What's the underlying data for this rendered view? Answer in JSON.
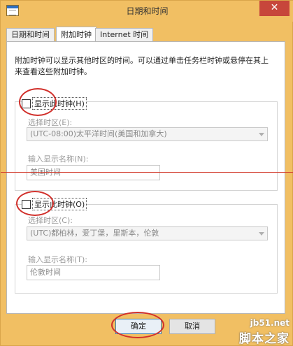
{
  "window": {
    "title": "日期和时间",
    "close_glyph": "✕"
  },
  "tabs": [
    {
      "label": "日期和时间"
    },
    {
      "label": "附加时钟"
    },
    {
      "label": "Internet 时间"
    }
  ],
  "description": "附加时钟可以显示其他时区的时间。可以通过单击任务栏时钟或悬停在其上来查看这些附加时钟。",
  "clock1": {
    "checkbox_label": "显示此时钟(H)",
    "checked": false,
    "timezone_label": "选择时区(E):",
    "timezone_value": "(UTC-08:00)太平洋时间(美国和加拿大)",
    "name_label": "输入显示名称(N):",
    "name_value": "美国时间"
  },
  "clock2": {
    "checkbox_label": "显示此时钟(O)",
    "checked": false,
    "timezone_label": "选择时区(C):",
    "timezone_value": "(UTC)都柏林，爱丁堡，里斯本，伦敦",
    "name_label": "输入显示名称(T):",
    "name_value": "伦敦时间"
  },
  "buttons": {
    "ok": "确定",
    "cancel": "取消"
  },
  "watermark": {
    "url": "jb51.net",
    "name": "脚本之家"
  },
  "colors": {
    "frame": "#f1bf63",
    "annotation": "#d1302b",
    "close_button": "#c7463b"
  }
}
